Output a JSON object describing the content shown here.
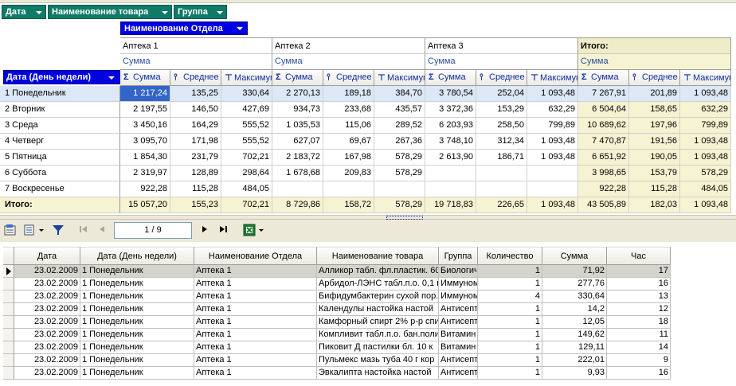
{
  "filters": [
    {
      "label": "Дата"
    },
    {
      "label": "Наименование товара"
    },
    {
      "label": "Группа"
    }
  ],
  "pivot": {
    "column_field": "Наименование Отдела",
    "row_field": "Дата (День недели)",
    "departments": [
      "Аптека 1",
      "Аптека 2",
      "Аптека 3",
      "Итого:"
    ],
    "sum_label": "Сумма",
    "measures": [
      "Сумма",
      "Среднее",
      "Максимум"
    ],
    "rows": [
      {
        "label": "1 Понедельник",
        "values": [
          "1 217,24",
          "135,25",
          "330,64",
          "2 270,13",
          "189,18",
          "384,70",
          "3 780,54",
          "252,04",
          "1 093,48",
          "7 267,91",
          "201,89",
          "1 093,48"
        ]
      },
      {
        "label": "2 Вторник",
        "values": [
          "2 197,55",
          "146,50",
          "427,69",
          "934,73",
          "233,68",
          "435,57",
          "3 372,36",
          "153,29",
          "632,29",
          "6 504,64",
          "158,65",
          "632,29"
        ]
      },
      {
        "label": "3 Среда",
        "values": [
          "3 450,16",
          "164,29",
          "555,52",
          "1 035,53",
          "115,06",
          "289,52",
          "6 203,93",
          "258,50",
          "799,89",
          "10 689,62",
          "197,96",
          "799,89"
        ]
      },
      {
        "label": "4 Четверг",
        "values": [
          "3 095,70",
          "171,98",
          "555,52",
          "627,07",
          "69,67",
          "267,36",
          "3 748,10",
          "312,34",
          "1 093,48",
          "7 470,87",
          "191,56",
          "1 093,48"
        ]
      },
      {
        "label": "5 Пятница",
        "values": [
          "1 854,30",
          "231,79",
          "702,21",
          "2 183,72",
          "167,98",
          "578,29",
          "2 613,90",
          "186,71",
          "1 093,48",
          "6 651,92",
          "190,05",
          "1 093,48"
        ]
      },
      {
        "label": "6 Суббота",
        "values": [
          "2 319,97",
          "128,89",
          "298,64",
          "1 678,68",
          "209,83",
          "578,29",
          "",
          "",
          "",
          "3 998,65",
          "153,79",
          "578,29"
        ]
      },
      {
        "label": "7 Воскресенье",
        "values": [
          "922,28",
          "115,28",
          "484,05",
          "",
          "",
          "",
          "",
          "",
          "",
          "922,28",
          "115,28",
          "484,05"
        ]
      }
    ],
    "total_row": {
      "label": "Итого:",
      "values": [
        "15 057,20",
        "155,23",
        "702,21",
        "8 729,86",
        "158,72",
        "578,29",
        "19 718,83",
        "226,65",
        "1 093,48",
        "43 505,89",
        "182,03",
        "1 093,48"
      ]
    }
  },
  "toolbar": {
    "page_indicator": "1 / 9",
    "icons": [
      "properties-icon",
      "export-icon",
      "filter-icon",
      "first-page-icon",
      "prev-page-icon",
      "next-page-icon",
      "last-page-icon",
      "excel-icon"
    ]
  },
  "grid": {
    "columns": [
      "Дата",
      "Дата (День недели)",
      "Наименование Отдела",
      "Наименование товара",
      "Группа",
      "Количество",
      "Сумма",
      "Час"
    ],
    "rows": [
      [
        "23.02.2009",
        "1 Понедельник",
        "Аптека 1",
        "Алликор табл. фл.пластик. 60",
        "Биологич",
        "1",
        "71,92",
        "17"
      ],
      [
        "23.02.2009",
        "1 Понедельник",
        "Аптека 1",
        "Арбидол-ЛЭНС табл.п.о. 0,1 г",
        "Иммуном",
        "1",
        "277,76",
        "16"
      ],
      [
        "23.02.2009",
        "1 Понедельник",
        "Аптека 1",
        "Бифидумбактерин сухой пор..",
        "Иммуном",
        "4",
        "330,64",
        "13"
      ],
      [
        "23.02.2009",
        "1 Понедельник",
        "Аптека 1",
        "Календулы настойка настой",
        "Антисепт",
        "1",
        "14,2",
        "12"
      ],
      [
        "23.02.2009",
        "1 Понедельник",
        "Аптека 1",
        "Камфорный спирт 2% р-р спи",
        "Антисепт",
        "1",
        "12,05",
        "18"
      ],
      [
        "23.02.2009",
        "1 Понедельник",
        "Аптека 1",
        "Компливит табл.п.о. бан.поли",
        "Витамин",
        "1",
        "149,62",
        "11"
      ],
      [
        "23.02.2009",
        "1 Понедельник",
        "Аптека 1",
        "Пиковит Д пастилки бл. 10 к",
        "Витамин",
        "1",
        "129,11",
        "14"
      ],
      [
        "23.02.2009",
        "1 Понедельник",
        "Аптека 1",
        "Пульмекс мазь туба 40 г кор",
        "Антисепт",
        "1",
        "222,01",
        "9"
      ],
      [
        "23.02.2009",
        "1 Понедельник",
        "Аптека 1",
        "Эвкалипта настойка настой",
        "Антисепт",
        "1",
        "9,93",
        "16"
      ]
    ]
  }
}
